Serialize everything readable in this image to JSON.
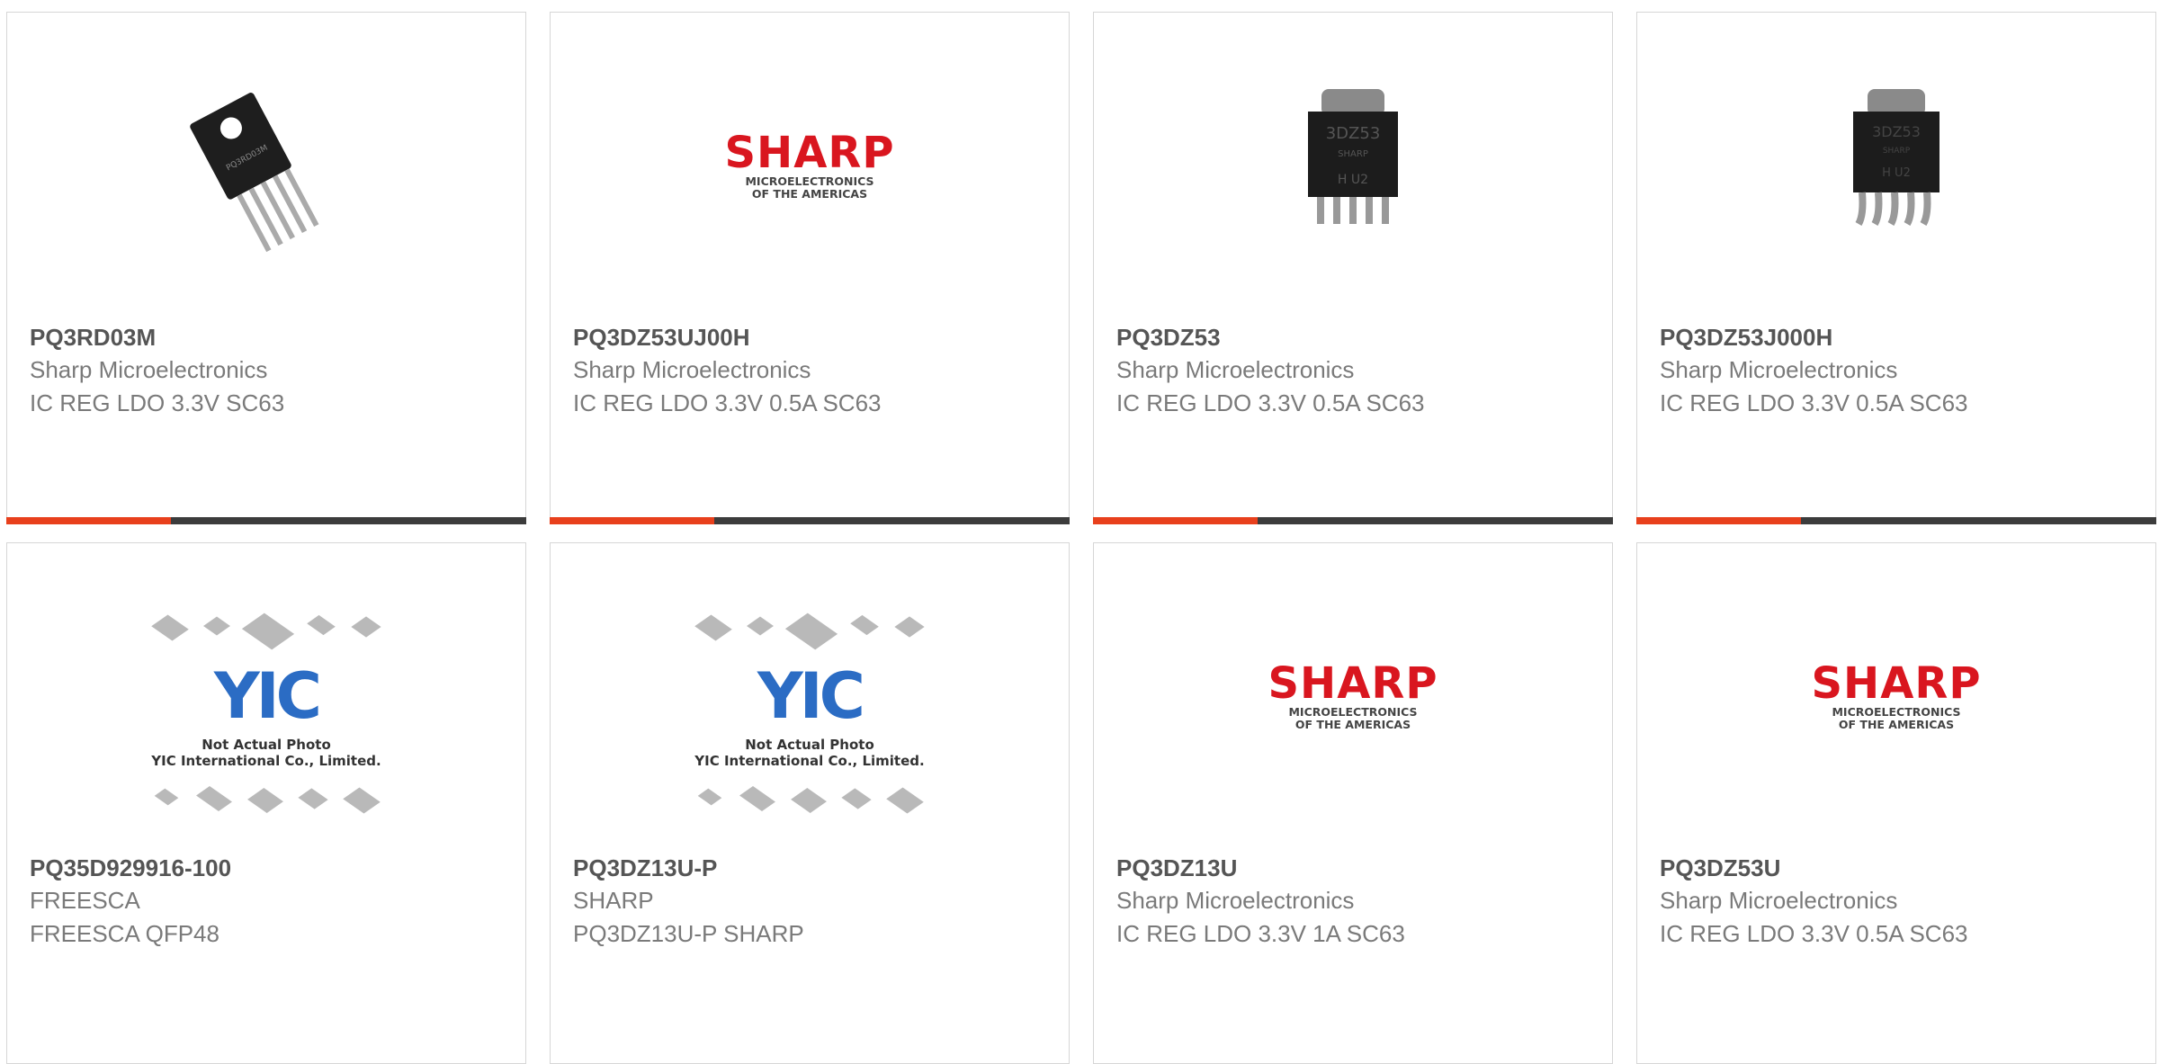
{
  "products": [
    {
      "part": "PQ3RD03M",
      "manufacturer": "Sharp Microelectronics",
      "description": "IC REG LDO 3.3V SC63",
      "image": "to220-5lead-photo"
    },
    {
      "part": "PQ3DZ53UJ00H",
      "manufacturer": "Sharp Microelectronics",
      "description": "IC REG LDO 3.3V 0.5A SC63",
      "image": "sharp-logo"
    },
    {
      "part": "PQ3DZ53",
      "manufacturer": "Sharp Microelectronics",
      "description": "IC REG LDO 3.3V 0.5A SC63",
      "image": "sc63-package-photo"
    },
    {
      "part": "PQ3DZ53J000H",
      "manufacturer": "Sharp Microelectronics",
      "description": "IC REG LDO 3.3V 0.5A SC63",
      "image": "sc63-package-photo"
    },
    {
      "part": "PQ35D929916-100",
      "manufacturer": "FREESCA",
      "description": "FREESCA QFP48",
      "image": "not-actual-photo"
    },
    {
      "part": "PQ3DZ13U-P",
      "manufacturer": "SHARP",
      "description": "PQ3DZ13U-P SHARP",
      "image": "not-actual-photo"
    },
    {
      "part": "PQ3DZ13U",
      "manufacturer": "Sharp Microelectronics",
      "description": "IC REG LDO 3.3V 1A SC63",
      "image": "sharp-logo"
    },
    {
      "part": "PQ3DZ53U",
      "manufacturer": "Sharp Microelectronics",
      "description": "IC REG LDO 3.3V 0.5A SC63",
      "image": "sharp-logo"
    }
  ],
  "sharp_logo": {
    "word": "SHARP",
    "line1": "MICROELECTRONICS",
    "line2": "OF THE AMERICAS"
  },
  "placeholder": {
    "logo_text": "YIC",
    "line1": "Not Actual Photo",
    "line2": "YIC International Co., Limited."
  },
  "chip_markings": {
    "pq3dz53": [
      "3DZ53",
      "SHARP",
      "H  U2"
    ],
    "pq3dz53j000h": [
      "3DZ53",
      "SHARP",
      "H U2"
    ],
    "pq3rd03m": "PQ3RD03M"
  },
  "colors": {
    "accent": "#e8401c",
    "bar": "#3c3c3c",
    "sharp_red": "#d9161f",
    "yic_blue": "#2b6cc4"
  }
}
